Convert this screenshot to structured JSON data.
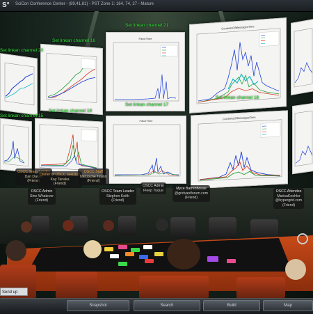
{
  "window": {
    "status_bar": "SciCon Conference Center - (89,41,81) - PST Zone 1: 164, 74, 27 - Mature"
  },
  "floating_labels": [
    {
      "text": "Set linkan channel 21",
      "key": "ch21"
    },
    {
      "text": "Set linkan channel 20",
      "key": "ch20"
    },
    {
      "text": "Set linkan channel 16",
      "key": "ch16"
    },
    {
      "text": "Set linkan channel 15",
      "key": "ch15"
    },
    {
      "text": "Set linkan channel 17",
      "key": "ch17"
    },
    {
      "text": "Set linkan channel 18",
      "key": "ch18"
    },
    {
      "text": "Set linkan channel 19",
      "key": "ch19"
    }
  ],
  "charts": {
    "top_center_title": "FavorTime",
    "top_right_title": "ContentsOfMessagesTime",
    "bottom_center_title": "FavorTime",
    "bottom_right_title": "ContentsOfMessagesTime",
    "legend_entries": [
      "Keyword 1",
      "Keyword 2",
      "Keyword 3",
      "Keyword 4"
    ]
  },
  "name_tags": [
    {
      "line1": "OSCC Team Leader",
      "line2": "Dan Daniel",
      "line3": "(Friend)",
      "style": "orange"
    },
    {
      "line1": "Owner of OSCC GROUP",
      "line2": "Kay Tanaka",
      "line3": "(Friend)",
      "style": "orange"
    },
    {
      "line1": "OSCC Admin",
      "line2": "Sine Whatever",
      "line3": "(Friend)",
      "style": "white"
    },
    {
      "line1": "OSCC Staff",
      "line2": "Nietzsche Tzunn",
      "line3": "(Friend)",
      "style": "orange"
    },
    {
      "line1": "OSCC Team Leader",
      "line2": "Stephen Keith",
      "line3": "(Friend)",
      "style": "white"
    },
    {
      "line1": "OSCC Admin",
      "line2": "Fleep Tuque",
      "line3": "",
      "style": "white"
    },
    {
      "line1": "Myce Barrenhouse",
      "line2": "@gridvaniforum.com",
      "line3": "(Friend)",
      "style": "white"
    },
    {
      "line1": "OSCC Attendee",
      "line2": "MarisaKoehler",
      "line3": "@hypergrid.com",
      "line4": "(Friend)",
      "style": "white"
    }
  ],
  "chat": {
    "label": "Send up"
  },
  "toolbar": {
    "snapshot_label": "Snapshot",
    "search_label": "Search",
    "build_label": "Build",
    "map_label": "Map"
  },
  "colors": {
    "float_label": "#34e03a",
    "table": "#c94a18",
    "chart_blue": "#1f3fd8",
    "chart_green": "#1e9e3a",
    "chart_red": "#d8361e",
    "chart_cyan": "#18b8c8"
  }
}
